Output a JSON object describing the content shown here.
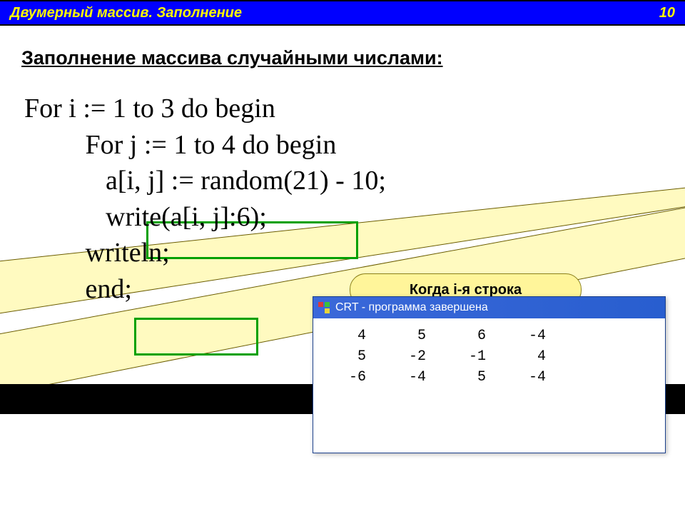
{
  "header": {
    "title": "Двумерный массив. Заполнение",
    "page_number": "10"
  },
  "subtitle": "Заполнение массива случайными числами:",
  "code": {
    "l1": "For i := 1 to 3 do begin",
    "l2": "         For j := 1 to 4 do begin",
    "l3": "            a[i, j] := random(21) - 10;",
    "l4": "            write(a[i, j]:6);",
    "l5": "         writeln;",
    "l6": "         end;"
  },
  "callout": {
    "text": "Когда i-я строка"
  },
  "crt": {
    "title": "CRT - программа завершена",
    "rows": [
      [
        "4",
        "5",
        "6",
        "-4"
      ],
      [
        "5",
        "-2",
        "-1",
        "4"
      ],
      [
        "-6",
        "-4",
        "5",
        "-4"
      ]
    ]
  }
}
